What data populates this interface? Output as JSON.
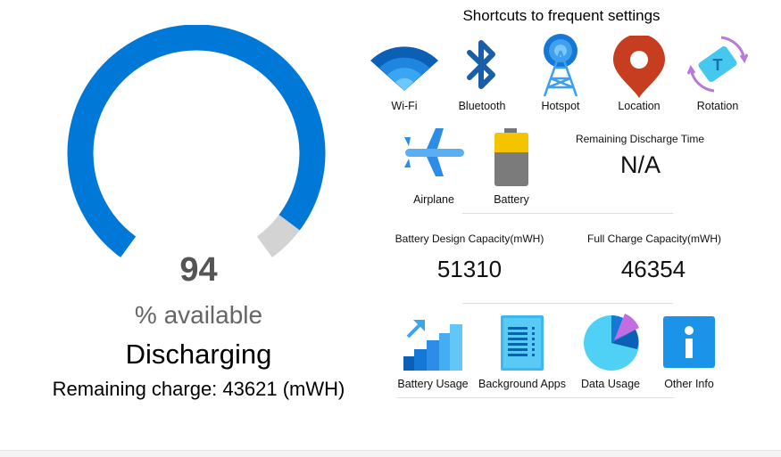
{
  "battery": {
    "percent": "94",
    "percent_value": 94,
    "available_label": "% available",
    "status": "Discharging",
    "remaining_charge": "Remaining charge: 43621 (mWH)",
    "gauge_color": "#0078d7",
    "gauge_track_color": "#d3d3d3"
  },
  "shortcuts": {
    "title": "Shortcuts to frequent settings",
    "items": [
      {
        "label": "Wi-Fi",
        "icon": "wifi-icon"
      },
      {
        "label": "Bluetooth",
        "icon": "bluetooth-icon"
      },
      {
        "label": "Hotspot",
        "icon": "hotspot-icon"
      },
      {
        "label": "Location",
        "icon": "location-icon"
      },
      {
        "label": "Rotation",
        "icon": "rotation-icon"
      },
      {
        "label": "Airplane",
        "icon": "airplane-icon"
      },
      {
        "label": "Battery",
        "icon": "battery-icon"
      }
    ]
  },
  "discharge": {
    "label": "Remaining Discharge Time",
    "value": "N/A"
  },
  "capacity": {
    "design_label": "Battery Design Capacity(mWH)",
    "design_value": "51310",
    "full_label": "Full Charge Capacity(mWH)",
    "full_value": "46354"
  },
  "tools": {
    "items": [
      {
        "label": "Battery Usage",
        "icon": "battery-usage-icon"
      },
      {
        "label": "Background Apps",
        "icon": "background-apps-icon"
      },
      {
        "label": "Data Usage",
        "icon": "data-usage-icon"
      },
      {
        "label": "Other Info",
        "icon": "info-icon"
      }
    ]
  }
}
